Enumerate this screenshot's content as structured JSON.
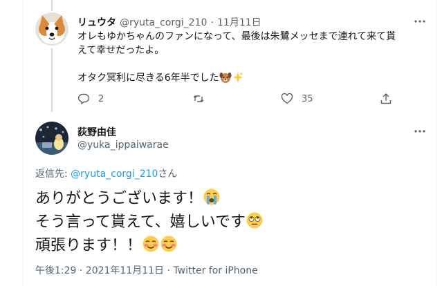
{
  "reply_tweet": {
    "display_name": "リュウタ",
    "handle": "@ryuta_corgi_210",
    "separator": "·",
    "date": "11月11日",
    "text_line1": "オレもゆかちゃんのファンになって、最後は朱鷺メッセまで連れて来て貰",
    "text_line2": "えて幸せだったよ。",
    "text_line3": "オタク冥利に尽きる6年半でした",
    "reply_count": "2",
    "retweet_count": "",
    "like_count": "35"
  },
  "main_tweet": {
    "display_name": "荻野由佳",
    "handle": "@yuka_ippaiwarae",
    "reply_to_label": "返信先: ",
    "reply_to_handle": "@ryuta_corgi_210",
    "reply_to_suffix": "さん",
    "line1": "ありがとうございます！",
    "line2": "そう言って貰えて、嬉しいです",
    "line3": "頑張ります！！",
    "timestamp": "午後1:29 · 2021年11月11日 · Twitter for iPhone"
  },
  "icons": {
    "reply": "comment-icon",
    "retweet": "retweet-icon",
    "like": "heart-icon",
    "share": "share-icon",
    "more": "more-horizontal-icon"
  },
  "colors": {
    "link": "#1d9bf0",
    "muted": "#536471",
    "text": "#0f1419"
  }
}
